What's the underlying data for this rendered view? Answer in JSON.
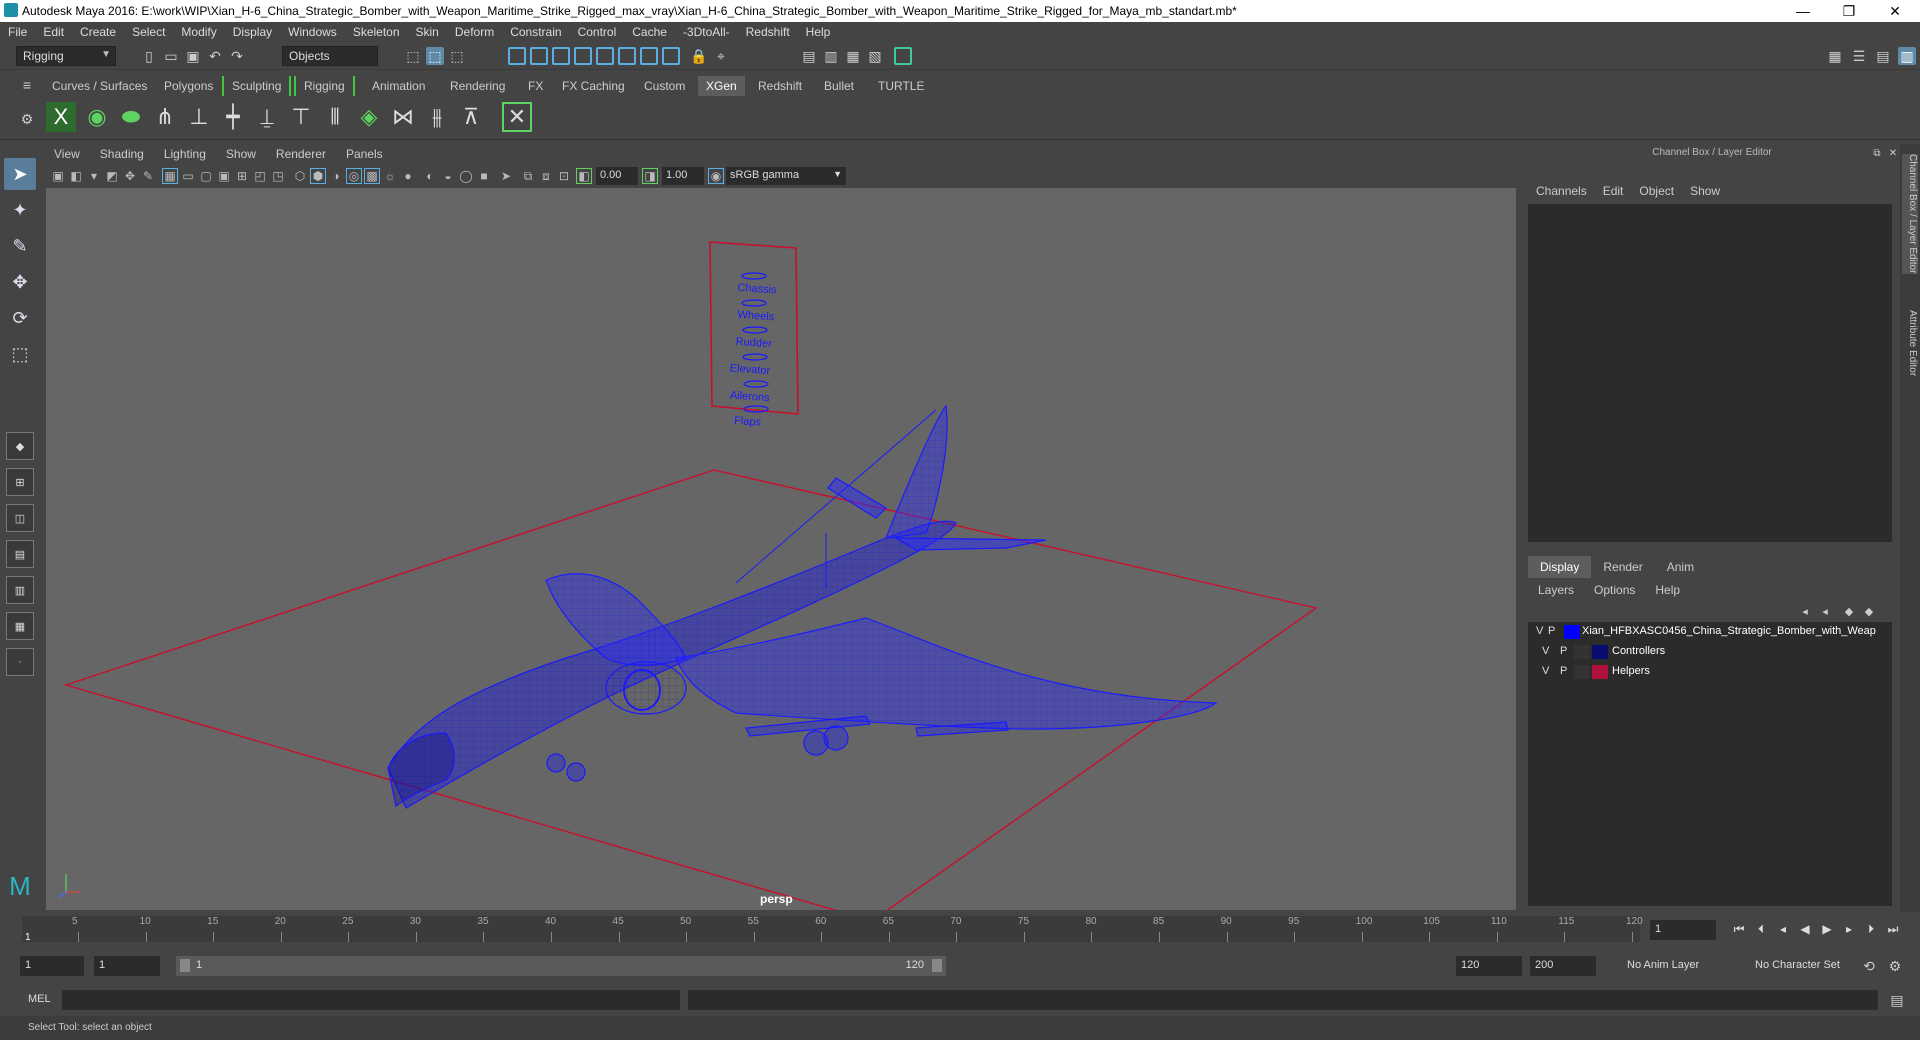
{
  "window": {
    "title": "Autodesk Maya 2016: E:\\work\\WIP\\Xian_H-6_China_Strategic_Bomber_with_Weapon_Maritime_Strike_Rigged_max_vray\\Xian_H-6_China_Strategic_Bomber_with_Weapon_Maritime_Strike_Rigged_for_Maya_mb_standart.mb*",
    "minimize": "—",
    "maximize": "❐",
    "close": "✕"
  },
  "menubar": [
    "File",
    "Edit",
    "Create",
    "Select",
    "Modify",
    "Display",
    "Windows",
    "Skeleton",
    "Skin",
    "Deform",
    "Constrain",
    "Control",
    "Cache",
    "-3DtoAll-",
    "Redshift",
    "Help"
  ],
  "statusline": {
    "menuset": "Rigging",
    "selection_mode": "Objects"
  },
  "shelf_tabs": [
    "Curves / Surfaces",
    "Polygons",
    "Sculpting",
    "Rigging",
    "Animation",
    "Rendering",
    "FX",
    "FX Caching",
    "Custom",
    "XGen",
    "Redshift",
    "Bullet",
    "TURTLE"
  ],
  "shelf_active_tab": "XGen",
  "viewport": {
    "menu": [
      "View",
      "Shading",
      "Lighting",
      "Show",
      "Renderer",
      "Panels"
    ],
    "exposure": "0.00",
    "gamma": "1.00",
    "color_space": "sRGB gamma",
    "camera_label": "persp",
    "controller_labels": [
      "Chassis",
      "Wheels",
      "Rudder",
      "Elevator",
      "Ailerons",
      "Flaps"
    ]
  },
  "channel_box": {
    "title": "Channel Box / Layer Editor",
    "menu": [
      "Channels",
      "Edit",
      "Object",
      "Show"
    ],
    "tabs": [
      "Display",
      "Render",
      "Anim"
    ],
    "active_tab": "Display",
    "layer_menu": [
      "Layers",
      "Options",
      "Help"
    ],
    "layers": [
      {
        "v": "V",
        "p": "P",
        "name": "Xian_HFBXASC0456_China_Strategic_Bomber_with_Weap",
        "color": "#0000ff"
      },
      {
        "v": "V",
        "p": "P",
        "name": "Controllers",
        "color": "#0b0b6e"
      },
      {
        "v": "V",
        "p": "P",
        "name": "Helpers",
        "color": "#b0113a"
      }
    ]
  },
  "side_tabs": [
    "Channel Box / Layer Editor",
    "Attribute Editor"
  ],
  "timeline": {
    "ticks": [
      "5",
      "10",
      "15",
      "20",
      "25",
      "30",
      "35",
      "40",
      "45",
      "50",
      "55",
      "60",
      "65",
      "70",
      "75",
      "80",
      "85",
      "90",
      "95",
      "100",
      "105",
      "110",
      "115",
      "120"
    ],
    "first_frame_label": "1",
    "current_frame": "1"
  },
  "range": {
    "start": "1",
    "playback_start": "1",
    "slider_start": "1",
    "slider_end": "120",
    "playback_end": "120",
    "end": "200",
    "anim_layer": "No Anim Layer",
    "character_set": "No Character Set"
  },
  "cmdline": {
    "label": "MEL"
  },
  "helpline": {
    "text": "Select Tool: select an object"
  },
  "colors": {
    "wire": "#1a1aff",
    "ground": "#c8102e",
    "accent": "#5f8aa8"
  }
}
